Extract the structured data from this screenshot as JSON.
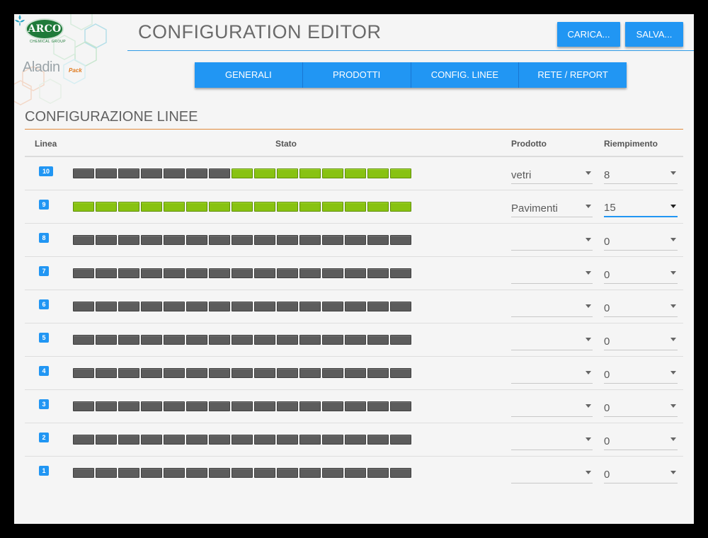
{
  "header": {
    "title": "CONFIGURATION EDITOR",
    "load_label": "CARICA...",
    "save_label": "SALVA..."
  },
  "logo": {
    "brand": "ARCO",
    "brand_sub": "CHEMICAL GROUP",
    "product": "Aladin",
    "product_sub": "Pack"
  },
  "tabs": [
    {
      "label": "GENERALI"
    },
    {
      "label": "PRODOTTI"
    },
    {
      "label": "CONFIG. LINEE"
    },
    {
      "label": "RETE / REPORT"
    }
  ],
  "section": {
    "title": "CONFIGURAZIONE LINEE"
  },
  "table": {
    "columns": [
      "Linea",
      "Stato",
      "Prodotto",
      "Riempimento"
    ],
    "rows": [
      {
        "line": "10",
        "filled": 8,
        "total": 15,
        "product": "vetri",
        "fill": "8"
      },
      {
        "line": "9",
        "filled": 15,
        "total": 15,
        "product": "Pavimenti",
        "fill": "15"
      },
      {
        "line": "8",
        "filled": 0,
        "total": 15,
        "product": "",
        "fill": "0"
      },
      {
        "line": "7",
        "filled": 0,
        "total": 15,
        "product": "",
        "fill": "0"
      },
      {
        "line": "6",
        "filled": 0,
        "total": 15,
        "product": "",
        "fill": "0"
      },
      {
        "line": "5",
        "filled": 0,
        "total": 15,
        "product": "",
        "fill": "0"
      },
      {
        "line": "4",
        "filled": 0,
        "total": 15,
        "product": "",
        "fill": "0"
      },
      {
        "line": "3",
        "filled": 0,
        "total": 15,
        "product": "",
        "fill": "0"
      },
      {
        "line": "2",
        "filled": 0,
        "total": 15,
        "product": "",
        "fill": "0"
      },
      {
        "line": "1",
        "filled": 0,
        "total": 15,
        "product": "",
        "fill": "0"
      }
    ]
  },
  "colors": {
    "accent": "#2196f3",
    "slot_filled": "#88c212",
    "slot_empty": "#5c5c5c",
    "section_rule": "#e08a3c"
  }
}
